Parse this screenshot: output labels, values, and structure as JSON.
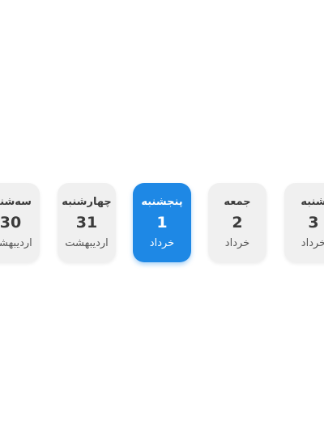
{
  "date_strip": {
    "days": [
      {
        "weekday": "سه‌شنبه",
        "day": "30",
        "month": "اردیبهشت",
        "selected": false
      },
      {
        "weekday": "چهارشنبه",
        "day": "31",
        "month": "اردیبهشت",
        "selected": false
      },
      {
        "weekday": "پنجشنبه",
        "day": "1",
        "month": "خرداد",
        "selected": true
      },
      {
        "weekday": "جمعه",
        "day": "2",
        "month": "خرداد",
        "selected": false
      },
      {
        "weekday": "شنبه",
        "day": "3",
        "month": "خرداد",
        "selected": false
      }
    ],
    "colors": {
      "selected_background": "#1e88e5",
      "card_background": "#f0f0f0",
      "text": "#3b3b3b"
    }
  }
}
